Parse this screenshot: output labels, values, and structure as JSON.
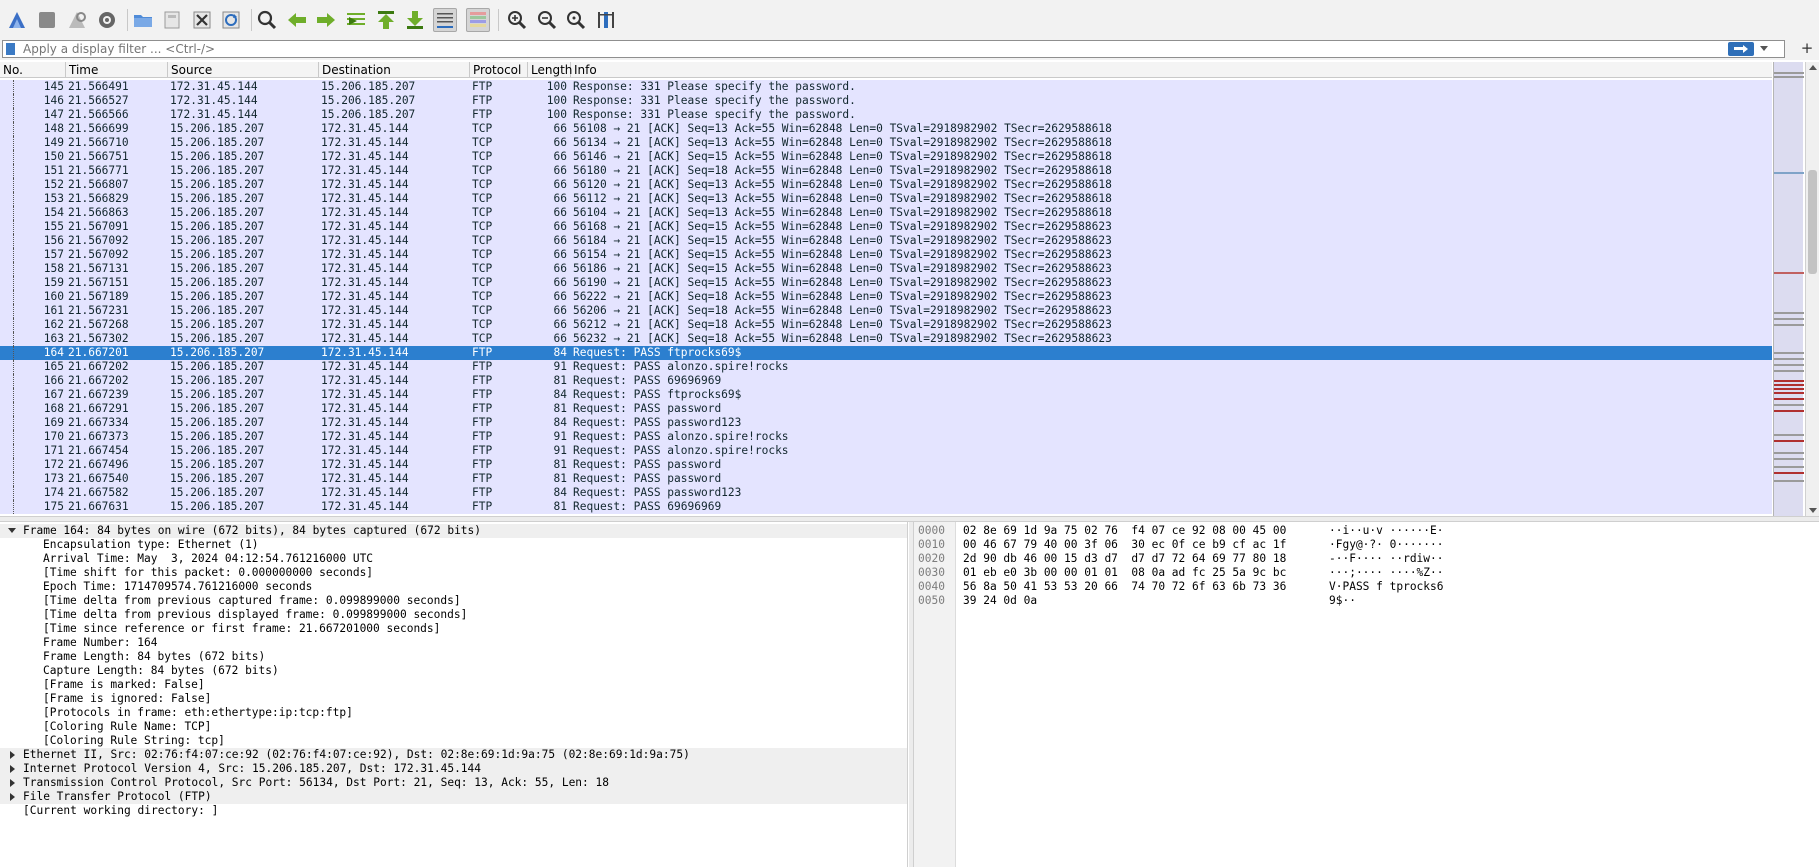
{
  "toolbar": {
    "buttons": [
      {
        "name": "start-capture-icon",
        "tooltip": "Start capturing packets"
      },
      {
        "name": "stop-capture-icon",
        "tooltip": "Stop capturing packets"
      },
      {
        "name": "restart-capture-icon",
        "tooltip": "Restart current capture"
      },
      {
        "name": "capture-options-icon",
        "tooltip": "Capture options"
      },
      {
        "name": "open-file-icon",
        "tooltip": "Open a capture file"
      },
      {
        "name": "save-file-icon",
        "tooltip": "Save this capture file"
      },
      {
        "name": "close-file-icon",
        "tooltip": "Close this capture file"
      },
      {
        "name": "reload-file-icon",
        "tooltip": "Reload this file"
      },
      {
        "name": "find-packet-icon",
        "tooltip": "Find a packet"
      },
      {
        "name": "go-back-icon",
        "tooltip": "Go back in packet history"
      },
      {
        "name": "go-forward-icon",
        "tooltip": "Go forward in packet history"
      },
      {
        "name": "go-to-packet-icon",
        "tooltip": "Go to packet"
      },
      {
        "name": "go-first-icon",
        "tooltip": "Go to first packet"
      },
      {
        "name": "go-last-icon",
        "tooltip": "Go to last packet"
      },
      {
        "name": "auto-scroll-icon",
        "tooltip": "Auto scroll"
      },
      {
        "name": "colorize-icon",
        "tooltip": "Colorize packet list"
      },
      {
        "name": "zoom-in-icon",
        "tooltip": "Zoom in"
      },
      {
        "name": "zoom-out-icon",
        "tooltip": "Zoom out"
      },
      {
        "name": "zoom-normal-icon",
        "tooltip": "Normal size"
      },
      {
        "name": "resize-columns-icon",
        "tooltip": "Resize columns"
      }
    ]
  },
  "filter": {
    "placeholder": "Apply a display filter ... <Ctrl-/>",
    "value": ""
  },
  "packet_list": {
    "columns": [
      "No.",
      "Time",
      "Source",
      "Destination",
      "Protocol",
      "Length",
      "Info"
    ],
    "rows": [
      {
        "no": "145",
        "time": "21.566491",
        "src": "172.31.45.144",
        "dst": "15.206.185.207",
        "proto": "FTP",
        "len": "100",
        "info": "Response: 331 Please specify the password."
      },
      {
        "no": "146",
        "time": "21.566527",
        "src": "172.31.45.144",
        "dst": "15.206.185.207",
        "proto": "FTP",
        "len": "100",
        "info": "Response: 331 Please specify the password."
      },
      {
        "no": "147",
        "time": "21.566566",
        "src": "172.31.45.144",
        "dst": "15.206.185.207",
        "proto": "FTP",
        "len": "100",
        "info": "Response: 331 Please specify the password."
      },
      {
        "no": "148",
        "time": "21.566699",
        "src": "15.206.185.207",
        "dst": "172.31.45.144",
        "proto": "TCP",
        "len": "66",
        "info": "56108 → 21 [ACK] Seq=13 Ack=55 Win=62848 Len=0 TSval=2918982902 TSecr=2629588618"
      },
      {
        "no": "149",
        "time": "21.566710",
        "src": "15.206.185.207",
        "dst": "172.31.45.144",
        "proto": "TCP",
        "len": "66",
        "info": "56134 → 21 [ACK] Seq=13 Ack=55 Win=62848 Len=0 TSval=2918982902 TSecr=2629588618"
      },
      {
        "no": "150",
        "time": "21.566751",
        "src": "15.206.185.207",
        "dst": "172.31.45.144",
        "proto": "TCP",
        "len": "66",
        "info": "56146 → 21 [ACK] Seq=15 Ack=55 Win=62848 Len=0 TSval=2918982902 TSecr=2629588618"
      },
      {
        "no": "151",
        "time": "21.566771",
        "src": "15.206.185.207",
        "dst": "172.31.45.144",
        "proto": "TCP",
        "len": "66",
        "info": "56180 → 21 [ACK] Seq=18 Ack=55 Win=62848 Len=0 TSval=2918982902 TSecr=2629588618"
      },
      {
        "no": "152",
        "time": "21.566807",
        "src": "15.206.185.207",
        "dst": "172.31.45.144",
        "proto": "TCP",
        "len": "66",
        "info": "56120 → 21 [ACK] Seq=13 Ack=55 Win=62848 Len=0 TSval=2918982902 TSecr=2629588618"
      },
      {
        "no": "153",
        "time": "21.566829",
        "src": "15.206.185.207",
        "dst": "172.31.45.144",
        "proto": "TCP",
        "len": "66",
        "info": "56112 → 21 [ACK] Seq=13 Ack=55 Win=62848 Len=0 TSval=2918982902 TSecr=2629588618"
      },
      {
        "no": "154",
        "time": "21.566863",
        "src": "15.206.185.207",
        "dst": "172.31.45.144",
        "proto": "TCP",
        "len": "66",
        "info": "56104 → 21 [ACK] Seq=13 Ack=55 Win=62848 Len=0 TSval=2918982902 TSecr=2629588618"
      },
      {
        "no": "155",
        "time": "21.567091",
        "src": "15.206.185.207",
        "dst": "172.31.45.144",
        "proto": "TCP",
        "len": "66",
        "info": "56168 → 21 [ACK] Seq=15 Ack=55 Win=62848 Len=0 TSval=2918982902 TSecr=2629588623"
      },
      {
        "no": "156",
        "time": "21.567092",
        "src": "15.206.185.207",
        "dst": "172.31.45.144",
        "proto": "TCP",
        "len": "66",
        "info": "56184 → 21 [ACK] Seq=15 Ack=55 Win=62848 Len=0 TSval=2918982902 TSecr=2629588623"
      },
      {
        "no": "157",
        "time": "21.567092",
        "src": "15.206.185.207",
        "dst": "172.31.45.144",
        "proto": "TCP",
        "len": "66",
        "info": "56154 → 21 [ACK] Seq=15 Ack=55 Win=62848 Len=0 TSval=2918982902 TSecr=2629588623"
      },
      {
        "no": "158",
        "time": "21.567131",
        "src": "15.206.185.207",
        "dst": "172.31.45.144",
        "proto": "TCP",
        "len": "66",
        "info": "56186 → 21 [ACK] Seq=15 Ack=55 Win=62848 Len=0 TSval=2918982902 TSecr=2629588623"
      },
      {
        "no": "159",
        "time": "21.567151",
        "src": "15.206.185.207",
        "dst": "172.31.45.144",
        "proto": "TCP",
        "len": "66",
        "info": "56190 → 21 [ACK] Seq=15 Ack=55 Win=62848 Len=0 TSval=2918982902 TSecr=2629588623"
      },
      {
        "no": "160",
        "time": "21.567189",
        "src": "15.206.185.207",
        "dst": "172.31.45.144",
        "proto": "TCP",
        "len": "66",
        "info": "56222 → 21 [ACK] Seq=18 Ack=55 Win=62848 Len=0 TSval=2918982902 TSecr=2629588623"
      },
      {
        "no": "161",
        "time": "21.567231",
        "src": "15.206.185.207",
        "dst": "172.31.45.144",
        "proto": "TCP",
        "len": "66",
        "info": "56206 → 21 [ACK] Seq=18 Ack=55 Win=62848 Len=0 TSval=2918982902 TSecr=2629588623"
      },
      {
        "no": "162",
        "time": "21.567268",
        "src": "15.206.185.207",
        "dst": "172.31.45.144",
        "proto": "TCP",
        "len": "66",
        "info": "56212 → 21 [ACK] Seq=18 Ack=55 Win=62848 Len=0 TSval=2918982902 TSecr=2629588623"
      },
      {
        "no": "163",
        "time": "21.567302",
        "src": "15.206.185.207",
        "dst": "172.31.45.144",
        "proto": "TCP",
        "len": "66",
        "info": "56232 → 21 [ACK] Seq=18 Ack=55 Win=62848 Len=0 TSval=2918982902 TSecr=2629588623"
      },
      {
        "no": "164",
        "time": "21.667201",
        "src": "15.206.185.207",
        "dst": "172.31.45.144",
        "proto": "FTP",
        "len": "84",
        "info": "Request: PASS ftprocks69$",
        "selected": true
      },
      {
        "no": "165",
        "time": "21.667202",
        "src": "15.206.185.207",
        "dst": "172.31.45.144",
        "proto": "FTP",
        "len": "91",
        "info": "Request: PASS alonzo.spire!rocks"
      },
      {
        "no": "166",
        "time": "21.667202",
        "src": "15.206.185.207",
        "dst": "172.31.45.144",
        "proto": "FTP",
        "len": "81",
        "info": "Request: PASS 69696969"
      },
      {
        "no": "167",
        "time": "21.667239",
        "src": "15.206.185.207",
        "dst": "172.31.45.144",
        "proto": "FTP",
        "len": "84",
        "info": "Request: PASS ftprocks69$"
      },
      {
        "no": "168",
        "time": "21.667291",
        "src": "15.206.185.207",
        "dst": "172.31.45.144",
        "proto": "FTP",
        "len": "81",
        "info": "Request: PASS password"
      },
      {
        "no": "169",
        "time": "21.667334",
        "src": "15.206.185.207",
        "dst": "172.31.45.144",
        "proto": "FTP",
        "len": "84",
        "info": "Request: PASS password123"
      },
      {
        "no": "170",
        "time": "21.667373",
        "src": "15.206.185.207",
        "dst": "172.31.45.144",
        "proto": "FTP",
        "len": "91",
        "info": "Request: PASS alonzo.spire!rocks"
      },
      {
        "no": "171",
        "time": "21.667454",
        "src": "15.206.185.207",
        "dst": "172.31.45.144",
        "proto": "FTP",
        "len": "91",
        "info": "Request: PASS alonzo.spire!rocks"
      },
      {
        "no": "172",
        "time": "21.667496",
        "src": "15.206.185.207",
        "dst": "172.31.45.144",
        "proto": "FTP",
        "len": "81",
        "info": "Request: PASS password"
      },
      {
        "no": "173",
        "time": "21.667540",
        "src": "15.206.185.207",
        "dst": "172.31.45.144",
        "proto": "FTP",
        "len": "81",
        "info": "Request: PASS password"
      },
      {
        "no": "174",
        "time": "21.667582",
        "src": "15.206.185.207",
        "dst": "172.31.45.144",
        "proto": "FTP",
        "len": "84",
        "info": "Request: PASS password123"
      },
      {
        "no": "175",
        "time": "21.667631",
        "src": "15.206.185.207",
        "dst": "172.31.45.144",
        "proto": "FTP",
        "len": "81",
        "info": "Request: PASS 69696969"
      }
    ]
  },
  "details": {
    "frame_header": "Frame 164: 84 bytes on wire (672 bits), 84 bytes captured (672 bits)",
    "frame_fields": [
      "Encapsulation type: Ethernet (1)",
      "Arrival Time: May  3, 2024 04:12:54.761216000 UTC",
      "[Time shift for this packet: 0.000000000 seconds]",
      "Epoch Time: 1714709574.761216000 seconds",
      "[Time delta from previous captured frame: 0.099899000 seconds]",
      "[Time delta from previous displayed frame: 0.099899000 seconds]",
      "[Time since reference or first frame: 21.667201000 seconds]",
      "Frame Number: 164",
      "Frame Length: 84 bytes (672 bits)",
      "Capture Length: 84 bytes (672 bits)",
      "[Frame is marked: False]",
      "[Frame is ignored: False]",
      "[Protocols in frame: eth:ethertype:ip:tcp:ftp]",
      "[Coloring Rule Name: TCP]",
      "[Coloring Rule String: tcp]"
    ],
    "collapsed": [
      "Ethernet II, Src: 02:76:f4:07:ce:92 (02:76:f4:07:ce:92), Dst: 02:8e:69:1d:9a:75 (02:8e:69:1d:9a:75)",
      "Internet Protocol Version 4, Src: 15.206.185.207, Dst: 172.31.45.144",
      "Transmission Control Protocol, Src Port: 56134, Dst Port: 21, Seq: 13, Ack: 55, Len: 18",
      "File Transfer Protocol (FTP)"
    ],
    "cwd": "[Current working directory: ]"
  },
  "bytes": [
    {
      "offset": "0000",
      "hex": "02 8e 69 1d 9a 75 02 76  f4 07 ce 92 08 00 45 00",
      "ascii": "··i··u·v ······E·"
    },
    {
      "offset": "0010",
      "hex": "00 46 67 79 40 00 3f 06  30 ec 0f ce b9 cf ac 1f",
      "ascii": "·Fgy@·?· 0·······"
    },
    {
      "offset": "0020",
      "hex": "2d 90 db 46 00 15 d3 d7  d7 d7 72 64 69 77 80 18",
      "ascii": "-··F···· ··rdiw··"
    },
    {
      "offset": "0030",
      "hex": "01 eb e0 3b 00 00 01 01  08 0a ad fc 25 5a 9c bc",
      "ascii": "···;···· ····%Z··"
    },
    {
      "offset": "0040",
      "hex": "56 8a 50 41 53 53 20 66  74 70 72 6f 63 6b 73 36",
      "ascii": "V·PASS f tprocks6"
    },
    {
      "offset": "0050",
      "hex": "39 24 0d 0a",
      "ascii": "9$··"
    }
  ],
  "colors": {
    "row_bg": "#e4e4ff",
    "selected_bg": "#2c7fcf",
    "row_text": "#12272e"
  }
}
